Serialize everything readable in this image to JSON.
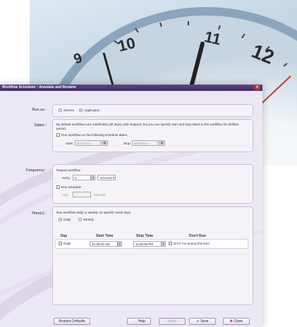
{
  "window": {
    "title": "Workflow Scheduler : Annotate and Rename",
    "close_glyph": "×"
  },
  "clock": {
    "numerals": [
      "9",
      "10",
      "11",
      "12"
    ]
  },
  "run_as": {
    "label": "Run as :",
    "options": [
      "Service",
      "Application"
    ],
    "selected": "Application"
  },
  "dates": {
    "label": "Dates :",
    "description": "By default workflow runs indefinitely (all days) until stopped, but you can specify start and stop dates to the workflow for definite period.",
    "checkbox_label": "Run workflow on the following schedule dates.",
    "start_label": "Start:",
    "start_value": "6/12/2014",
    "stop_label": "Stop:",
    "stop_value": "6/13/2014"
  },
  "frequency": {
    "label": "Frequency :",
    "repeat_label": "Repeat workflow",
    "every_label": "every",
    "every_value": "5",
    "unit_value": "seconds",
    "run_schedule_label": "Run schedule",
    "until_label": "until",
    "intervals_label": "intervals"
  },
  "times": {
    "label": "Time(s) :",
    "description": "Run workflow daily or weekly on specific week days.",
    "mode_options": [
      "Daily",
      "Weekly"
    ],
    "mode_selected": "Daily",
    "columns": [
      "Day",
      "Start Time",
      "Stop Time",
      "Don't Run"
    ],
    "rows": [
      {
        "day": "Daily",
        "start": "12:00:00 AM",
        "stop": "11:59:59 PM",
        "dont_run": "Don't run during this time"
      }
    ]
  },
  "footer": {
    "restore": "Restore Defaults",
    "help": "Help",
    "apply": "Apply",
    "save": "Save",
    "close": "Close"
  }
}
